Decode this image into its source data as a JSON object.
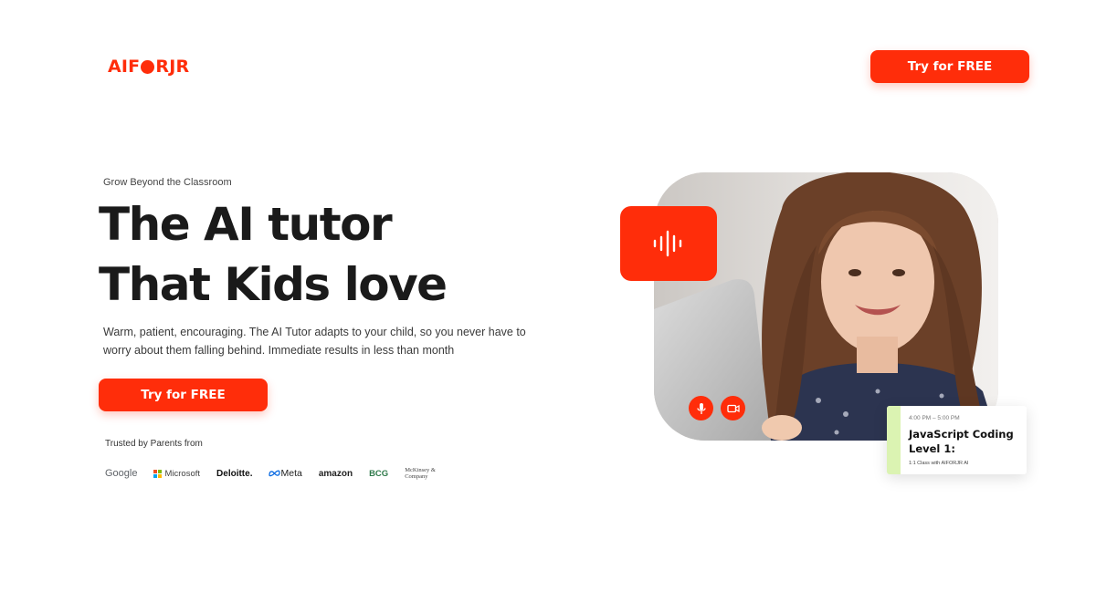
{
  "header": {
    "logo_left": "AIF",
    "logo_right": "RJR",
    "cta_label": "Try for FREE"
  },
  "hero": {
    "eyebrow": "Grow Beyond the Classroom",
    "headline_line1": "The AI tutor",
    "headline_line2": "That Kids love",
    "description": "Warm, patient, encouraging. The AI Tutor adapts to your child, so you never have to worry about them falling behind. Immediate results in less than month",
    "cta_label": "Try for FREE"
  },
  "trusted": {
    "label": "Trusted by Parents from",
    "brands": [
      "Google",
      "Microsoft",
      "Deloitte.",
      "Meta",
      "amazon",
      "BCG",
      "McKinsey & Company"
    ]
  },
  "call_card": {
    "voice_icon": "audio-waveform-icon",
    "mic_icon": "microphone-icon",
    "camera_icon": "video-camera-icon"
  },
  "class_card": {
    "time": "4:00 PM – 5:00 PM",
    "title": "JavaScript Coding Level 1:",
    "subtitle": "1:1 Class with AIFORJR AI"
  },
  "colors": {
    "accent": "#ff2d0a",
    "class_bar": "#dbf3b2",
    "text": "#1a1a1a"
  }
}
